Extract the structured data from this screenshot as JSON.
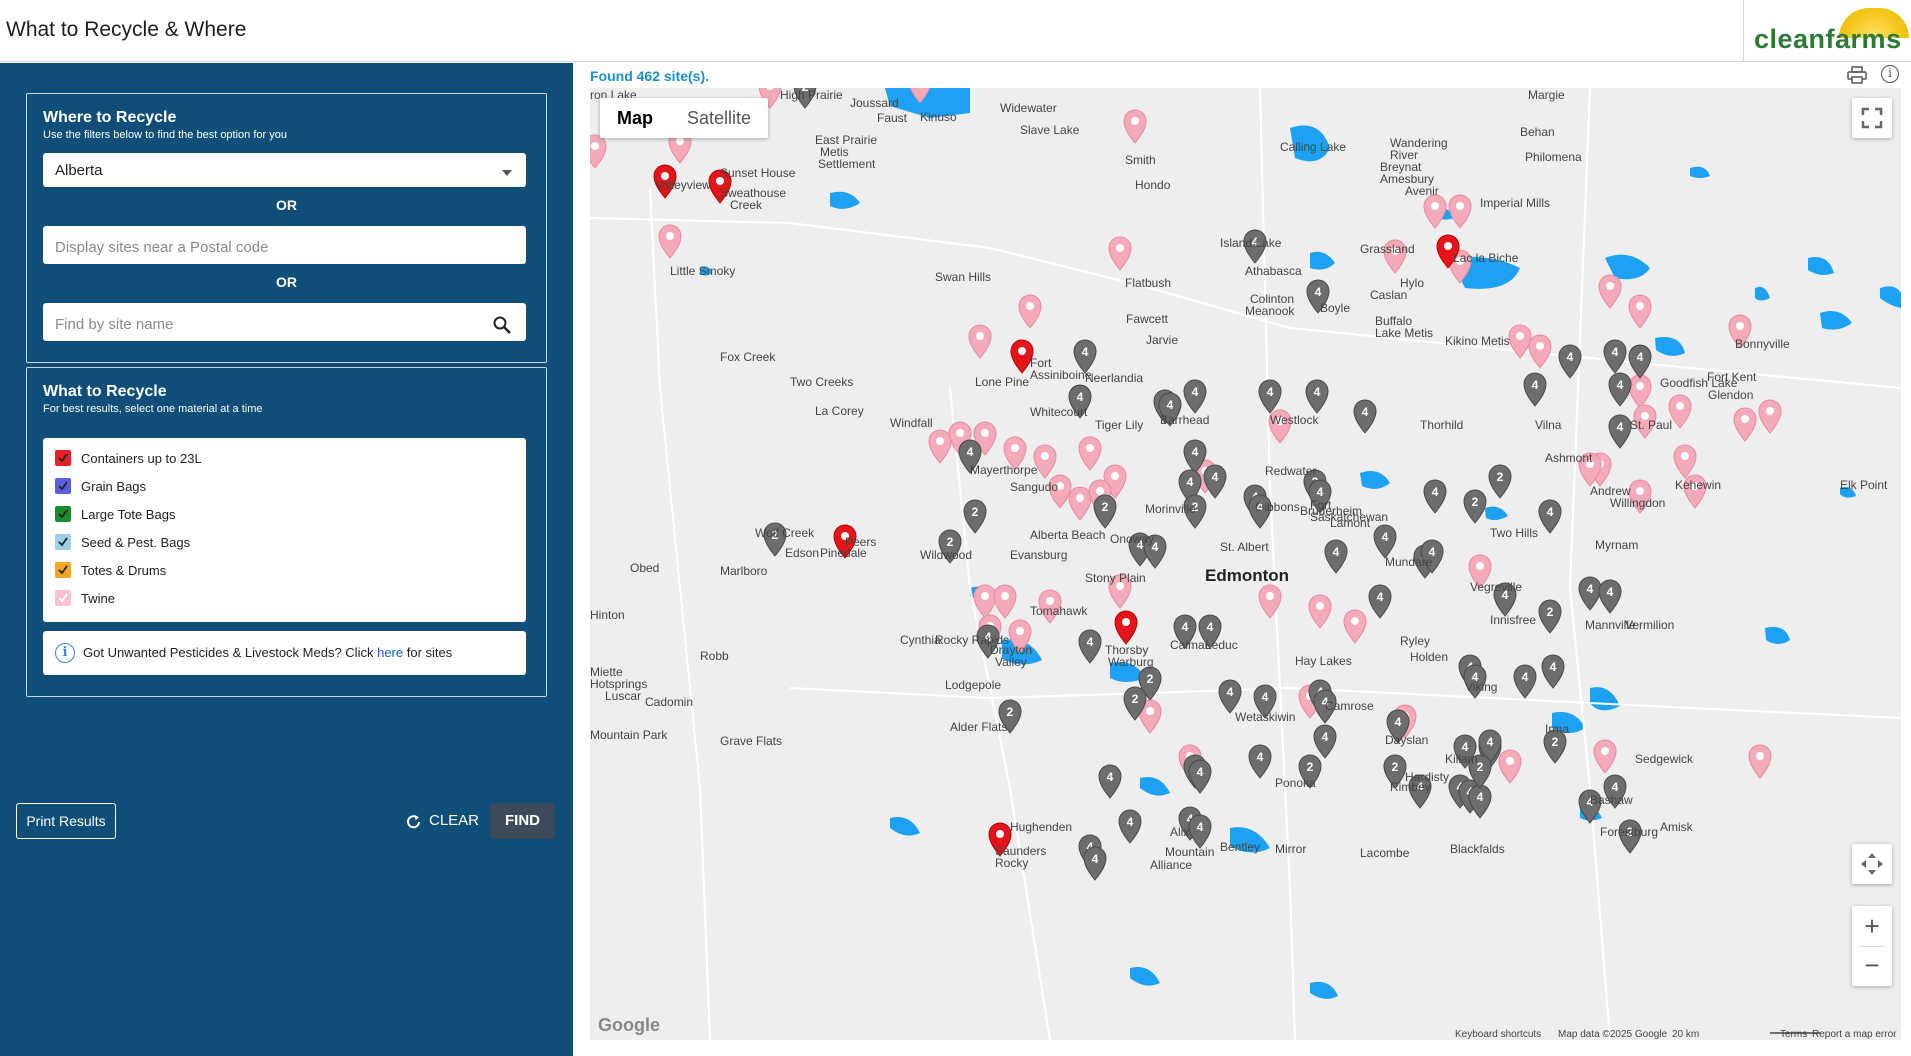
{
  "header": {
    "title": "What to Recycle & Where",
    "logo_text": "cleanfarms"
  },
  "where_panel": {
    "title": "Where to Recycle",
    "subtitle": "Use the filters below to find the best option for you",
    "province_value": "Alberta",
    "or_1": "OR",
    "postal_placeholder": "Display sites near a Postal code",
    "or_2": "OR",
    "site_name_placeholder": "Find by site name"
  },
  "what_panel": {
    "title": "What to Recycle",
    "subtitle": "For best results, select one material at a time",
    "materials": [
      {
        "label": "Containers up to 23L",
        "color": "#e8202a",
        "checked": true
      },
      {
        "label": "Grain Bags",
        "color": "#5a5fe0",
        "checked": true
      },
      {
        "label": "Large Tote Bags",
        "color": "#1e8a2e",
        "checked": true
      },
      {
        "label": "Seed & Pest. Bags",
        "color": "#9fd0ea",
        "checked": true
      },
      {
        "label": "Totes & Drums",
        "color": "#f5a623",
        "checked": true
      },
      {
        "label": "Twine",
        "color": "#f9c3cf",
        "checked": true
      }
    ],
    "info_prefix": "Got Unwanted Pesticides & Livestock Meds? Click",
    "info_link": "here",
    "info_suffix": "for sites"
  },
  "actions": {
    "print_label": "Print Results",
    "clear_label": "CLEAR",
    "find_label": "FIND"
  },
  "results": {
    "found_text": "Found 462 site(s)."
  },
  "map": {
    "type_map": "Map",
    "type_satellite": "Satellite",
    "zoom_in": "+",
    "zoom_out": "−",
    "google": "Google",
    "attribution": {
      "shortcuts": "Keyboard shortcuts",
      "data": "Map data ©2025 Google",
      "scale": "20 km",
      "terms": "Terms",
      "report": "Report a map error"
    },
    "places": [
      {
        "name": "Edmonton",
        "big": true
      },
      {
        "name": "High Prairie"
      },
      {
        "name": "Joussard"
      },
      {
        "name": "Faust"
      },
      {
        "name": "Kinuso"
      },
      {
        "name": "Widewater"
      },
      {
        "name": "Slave Lake"
      },
      {
        "name": "East Prairie"
      },
      {
        "name": "Metis"
      },
      {
        "name": "Settlement"
      },
      {
        "name": "Calling Lake"
      },
      {
        "name": "Wandering"
      },
      {
        "name": "River"
      },
      {
        "name": "Breynat"
      },
      {
        "name": "Amesbury"
      },
      {
        "name": "Behan"
      },
      {
        "name": "Philomena"
      },
      {
        "name": "Avenir"
      },
      {
        "name": "Imperial Mills"
      },
      {
        "name": "Margie"
      },
      {
        "name": "Smith"
      },
      {
        "name": "Hondo"
      },
      {
        "name": "Valleyview"
      },
      {
        "name": "Sunset House"
      },
      {
        "name": "Sweathouse"
      },
      {
        "name": "Creek"
      },
      {
        "name": "Little Smoky"
      },
      {
        "name": "Swan Hills"
      },
      {
        "name": "Island Lake"
      },
      {
        "name": "Athabasca"
      },
      {
        "name": "Grassland"
      },
      {
        "name": "Lac la Biche"
      },
      {
        "name": "Flatbush"
      },
      {
        "name": "Colinton"
      },
      {
        "name": "Meanook"
      },
      {
        "name": "Boyle"
      },
      {
        "name": "Caslan"
      },
      {
        "name": "Hylo"
      },
      {
        "name": "Fawcett"
      },
      {
        "name": "Jarvie"
      },
      {
        "name": "Buffalo"
      },
      {
        "name": "Lake Metis"
      },
      {
        "name": "Kikino Metis"
      },
      {
        "name": "Fox Creek"
      },
      {
        "name": "Two Creeks"
      },
      {
        "name": "Fort"
      },
      {
        "name": "Assiniboine"
      },
      {
        "name": "Lone Pine"
      },
      {
        "name": "Neerlandia"
      },
      {
        "name": "Goodfish Lake"
      },
      {
        "name": "Glendon"
      },
      {
        "name": "Fort Kent"
      },
      {
        "name": "Bonnyville"
      },
      {
        "name": "La Corey"
      },
      {
        "name": "Windfall"
      },
      {
        "name": "Whitecourt"
      },
      {
        "name": "Tiger Lily"
      },
      {
        "name": "Barrhead"
      },
      {
        "name": "Westlock"
      },
      {
        "name": "Thorhild"
      },
      {
        "name": "Vilna"
      },
      {
        "name": "Ashmont"
      },
      {
        "name": "St. Paul"
      },
      {
        "name": "Kehewin"
      },
      {
        "name": "Elk Point"
      },
      {
        "name": "Mayerthorpe"
      },
      {
        "name": "Sangudo"
      },
      {
        "name": "Redwater"
      },
      {
        "name": "Andrew"
      },
      {
        "name": "Willingdon"
      },
      {
        "name": "Morinville"
      },
      {
        "name": "Gibbons"
      },
      {
        "name": "Bruderheim"
      },
      {
        "name": "Lamont"
      },
      {
        "name": "Two Hills"
      },
      {
        "name": "Myrnam"
      },
      {
        "name": "Peers"
      },
      {
        "name": "Wolf Creek"
      },
      {
        "name": "Edson"
      },
      {
        "name": "Pinedale"
      },
      {
        "name": "Wildwood"
      },
      {
        "name": "Evansburg"
      },
      {
        "name": "Alberta Beach"
      },
      {
        "name": "Onoway"
      },
      {
        "name": "St. Albert"
      },
      {
        "name": "Fort"
      },
      {
        "name": "Saskatchewan"
      },
      {
        "name": "Mundare"
      },
      {
        "name": "Vegreville"
      },
      {
        "name": "Obed"
      },
      {
        "name": "Marlboro"
      },
      {
        "name": "Stony Plain"
      },
      {
        "name": "Hinton"
      },
      {
        "name": "Tomahawk"
      },
      {
        "name": "Innisfree"
      },
      {
        "name": "Mannville"
      },
      {
        "name": "Vermilion"
      },
      {
        "name": "Cynthia"
      },
      {
        "name": "Rocky Rapids"
      },
      {
        "name": "Drayton"
      },
      {
        "name": "Valley"
      },
      {
        "name": "Thorsby"
      },
      {
        "name": "Warburg"
      },
      {
        "name": "Calmar"
      },
      {
        "name": "Leduc"
      },
      {
        "name": "Ryley"
      },
      {
        "name": "Holden"
      },
      {
        "name": "Robb"
      },
      {
        "name": "Hay Lakes"
      },
      {
        "name": "Miette"
      },
      {
        "name": "Hotsprings"
      },
      {
        "name": "Luscar"
      },
      {
        "name": "Cadomin"
      },
      {
        "name": "Lodgepole"
      },
      {
        "name": "Viking"
      },
      {
        "name": "Wetaskiwin"
      },
      {
        "name": "Camrose"
      },
      {
        "name": "Mountain Park"
      },
      {
        "name": "Grave Flats"
      },
      {
        "name": "Alder Flats"
      },
      {
        "name": "Irma"
      },
      {
        "name": "Dayslan"
      },
      {
        "name": "Killam"
      },
      {
        "name": "Sedgewick"
      },
      {
        "name": "Hardisty"
      },
      {
        "name": "Ponoka"
      },
      {
        "name": "Rimbey"
      },
      {
        "name": "Bashaw"
      },
      {
        "name": "Forestburg"
      },
      {
        "name": "Amisk"
      },
      {
        "name": "Hughenden"
      },
      {
        "name": "Saunders"
      },
      {
        "name": "Rocky"
      },
      {
        "name": "Mountain"
      },
      {
        "name": "Bentley"
      },
      {
        "name": "Lacombe"
      },
      {
        "name": "Mirror"
      },
      {
        "name": "Alliance"
      },
      {
        "name": "Blackfalds"
      },
      {
        "name": "Alix"
      },
      {
        "name": "ron Lake"
      }
    ]
  },
  "colors": {
    "sidebar": "#0f4e78",
    "twine_pin": "#f4aab9",
    "container_pin": "#e3151b",
    "cluster": "#6d6d6d",
    "water": "#1da1f2",
    "found": "#1a8fd0"
  }
}
